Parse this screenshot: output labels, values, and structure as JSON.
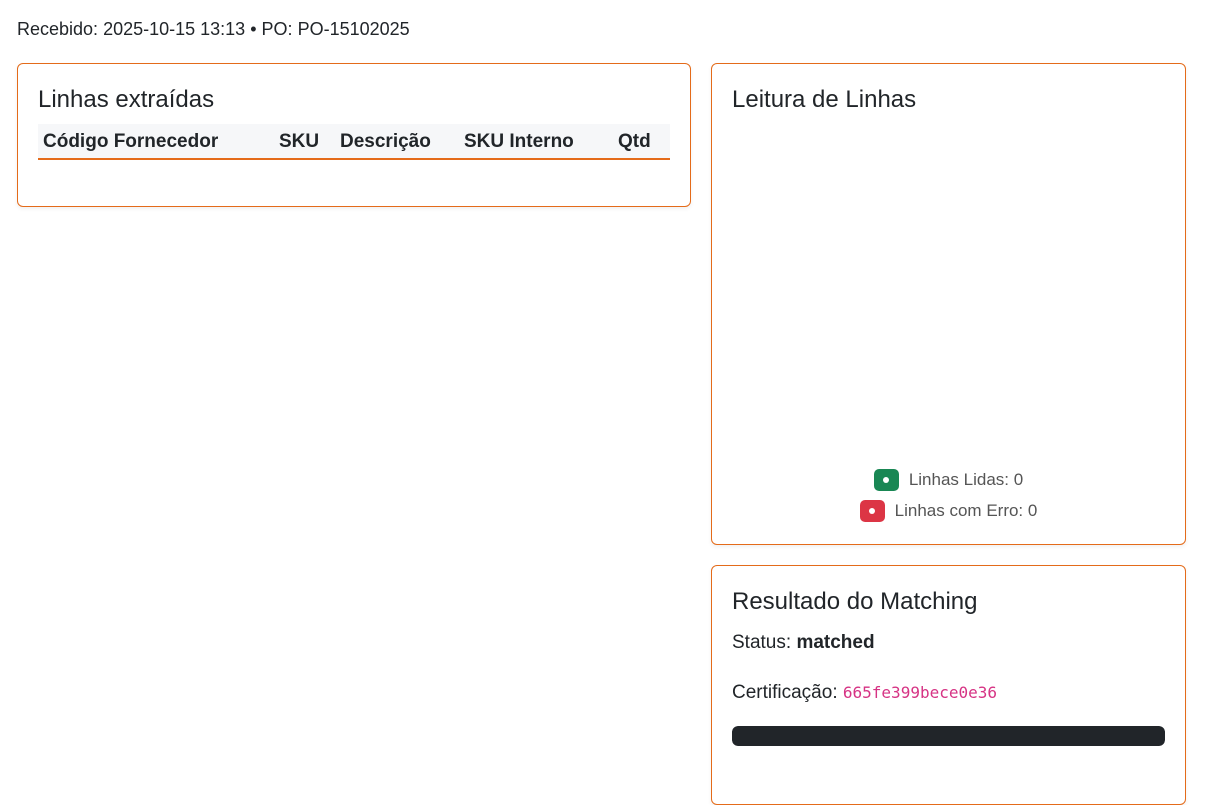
{
  "header": {
    "received_label": "Recebido:",
    "received_value": "2025-10-15 13:13",
    "separator": "•",
    "po_label": "PO:",
    "po_value": "PO-15102025"
  },
  "extracted_lines": {
    "title": "Linhas extraídas",
    "columns": [
      "Código Fornecedor",
      "SKU",
      "Descrição",
      "SKU Interno",
      "Qtd"
    ],
    "rows": []
  },
  "line_reading": {
    "title": "Leitura de Linhas",
    "legend": [
      {
        "label": "Linhas Lidas: 0",
        "color": "#198754"
      },
      {
        "label": "Linhas com Erro: 0",
        "color": "#dc3545"
      }
    ]
  },
  "matching": {
    "title": "Resultado do Matching",
    "status_label": "Status:",
    "status_value": "matched",
    "cert_label": "Certificação:",
    "cert_value": "665fe399bece0e36",
    "progress_fraction": 1.0
  },
  "colors": {
    "accent": "#e46b1a",
    "ok": "#198754",
    "error": "#dc3545",
    "code": "#d63384",
    "progress": "#212529"
  }
}
